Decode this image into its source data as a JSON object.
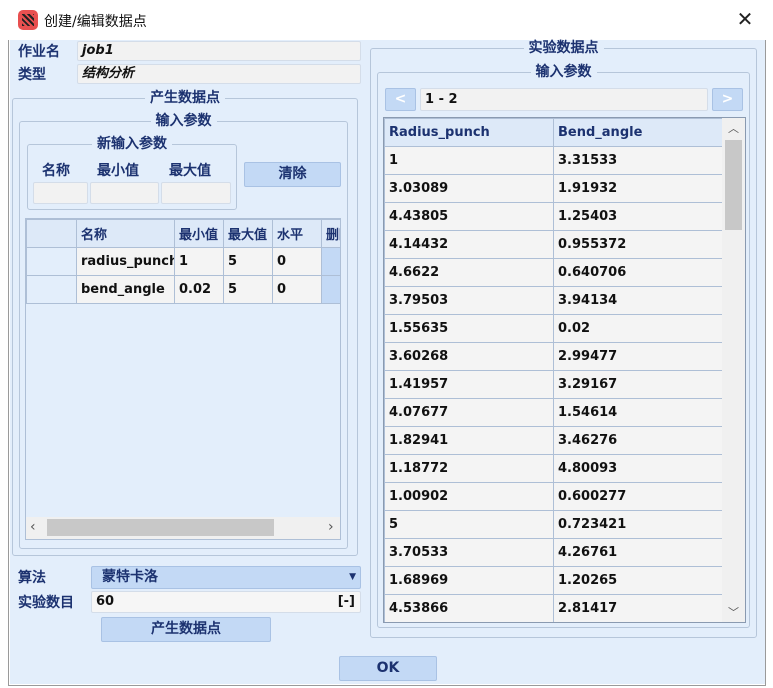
{
  "window": {
    "title": "创建/编辑数据点",
    "close_icon": "close-icon"
  },
  "job": {
    "label": "作业名",
    "value": "job1"
  },
  "type": {
    "label": "类型",
    "value": "结构分析"
  },
  "generate_group": {
    "title": "产生数据点",
    "input_params_title": "输入参数",
    "new_input": {
      "title": "新输入参数",
      "name_label": "名称",
      "min_label": "最小值",
      "max_label": "最大值",
      "name_value": "",
      "min_value": "",
      "max_value": ""
    },
    "clear_button": "清除",
    "table": {
      "headers": [
        "",
        "名称",
        "最小值",
        "最大值",
        "水平",
        "删除"
      ],
      "rows": [
        {
          "name": "radius_punch",
          "min": "1",
          "max": "5",
          "level": "0"
        },
        {
          "name": "bend_angle",
          "min": "0.02",
          "max": "5",
          "level": "0"
        }
      ]
    }
  },
  "algorithm": {
    "label": "算法",
    "value": "蒙特卡洛"
  },
  "count": {
    "label": "实验数目",
    "value": "60",
    "unit": "[-]"
  },
  "generate_button": "产生数据点",
  "ok_button": "OK",
  "experiment": {
    "title": "实验数据点",
    "input_params_title": "输入参数",
    "prev": "<",
    "next": ">",
    "range": "1 - 2",
    "headers": [
      "Radius_punch",
      "Bend_angle"
    ],
    "rows": [
      [
        "1",
        "3.31533"
      ],
      [
        "3.03089",
        "1.91932"
      ],
      [
        "4.43805",
        "1.25403"
      ],
      [
        "4.14432",
        "0.955372"
      ],
      [
        "4.6622",
        "0.640706"
      ],
      [
        "3.79503",
        "3.94134"
      ],
      [
        "1.55635",
        "0.02"
      ],
      [
        "3.60268",
        "2.99477"
      ],
      [
        "1.41957",
        "3.29167"
      ],
      [
        "4.07677",
        "1.54614"
      ],
      [
        "1.82941",
        "3.46276"
      ],
      [
        "1.18772",
        "4.80093"
      ],
      [
        "1.00902",
        "0.600277"
      ],
      [
        "5",
        "0.723421"
      ],
      [
        "3.70533",
        "4.26761"
      ],
      [
        "1.68969",
        "1.20265"
      ],
      [
        "4.53866",
        "2.81417"
      ]
    ]
  }
}
